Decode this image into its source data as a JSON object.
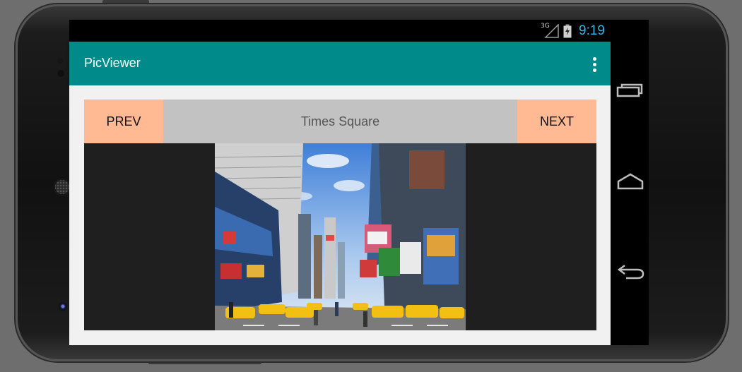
{
  "status_bar": {
    "network_label": "3G",
    "time": "9:19",
    "clock_color": "#33b5e5"
  },
  "app_bar": {
    "title": "PicViewer",
    "color": "#008b8b",
    "menu_icon": "overflow-menu-icon"
  },
  "viewer": {
    "prev_label": "PREV",
    "next_label": "NEXT",
    "caption": "Times Square",
    "button_color": "#ffba93",
    "caption_bg": "#c2c2c2"
  },
  "navigation_bar": {
    "icons": [
      "recent-apps-icon",
      "home-icon",
      "back-icon"
    ]
  }
}
